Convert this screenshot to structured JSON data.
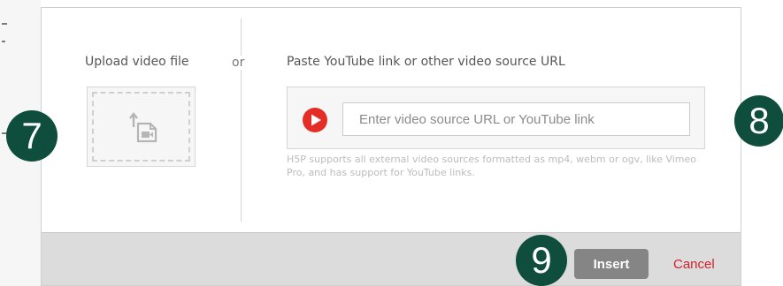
{
  "dialog": {
    "upload": {
      "label": "Upload video file",
      "icon": "upload-video-icon"
    },
    "or_label": "or",
    "url": {
      "label": "Paste YouTube link or other video source URL",
      "input_placeholder": "Enter video source URL or YouTube link",
      "input_value": "",
      "icon": "youtube-play-icon",
      "help_text": "H5P supports all external video sources formatted as mp4, webm or ogv, like Vimeo Pro, and has support for YouTube links."
    },
    "footer": {
      "insert_label": "Insert",
      "cancel_label": "Cancel"
    }
  },
  "annotations": {
    "step_7": "7",
    "step_8": "8",
    "step_9": "9"
  },
  "colors": {
    "badge": "#0f4d3c",
    "insert_button": "#858585",
    "cancel_link": "#d3212d",
    "youtube_red": "#e52d27"
  }
}
